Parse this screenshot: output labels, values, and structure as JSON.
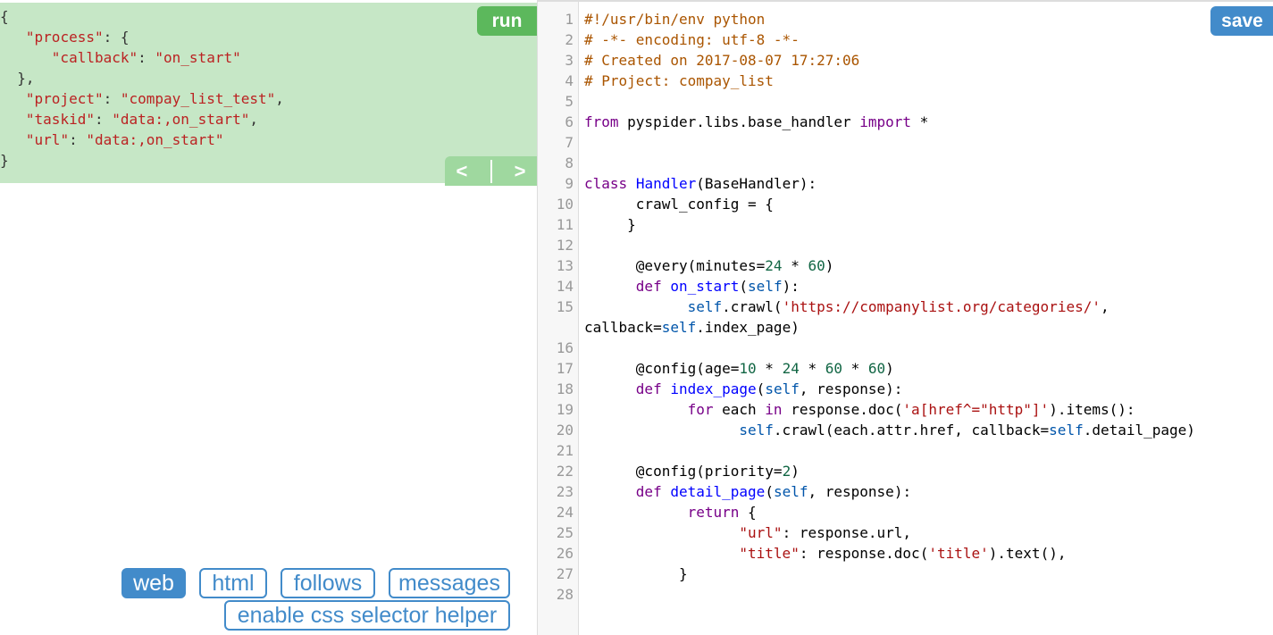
{
  "left_panel": {
    "task_json": {
      "lines": [
        [
          {
            "t": "{",
            "c": "p"
          }
        ],
        [
          {
            "t": "   ",
            "c": "p"
          },
          {
            "t": "\"process\"",
            "c": "s"
          },
          {
            "t": ": {",
            "c": "p"
          }
        ],
        [
          {
            "t": "      ",
            "c": "p"
          },
          {
            "t": "\"callback\"",
            "c": "s"
          },
          {
            "t": ": ",
            "c": "p"
          },
          {
            "t": "\"on_start\"",
            "c": "s"
          }
        ],
        [
          {
            "t": "  },",
            "c": "p"
          }
        ],
        [
          {
            "t": "   ",
            "c": "p"
          },
          {
            "t": "\"project\"",
            "c": "s"
          },
          {
            "t": ": ",
            "c": "p"
          },
          {
            "t": "\"compay_list_test\"",
            "c": "s"
          },
          {
            "t": ",",
            "c": "p"
          }
        ],
        [
          {
            "t": "   ",
            "c": "p"
          },
          {
            "t": "\"taskid\"",
            "c": "s"
          },
          {
            "t": ": ",
            "c": "p"
          },
          {
            "t": "\"data:,on_start\"",
            "c": "s"
          },
          {
            "t": ",",
            "c": "p"
          }
        ],
        [
          {
            "t": "   ",
            "c": "p"
          },
          {
            "t": "\"url\"",
            "c": "s"
          },
          {
            "t": ": ",
            "c": "p"
          },
          {
            "t": "\"data:,on_start\"",
            "c": "s"
          }
        ],
        [
          {
            "t": "}",
            "c": "p"
          }
        ]
      ]
    },
    "run_label": "run",
    "prev_label": "<",
    "next_label": ">",
    "tabs": {
      "web": "web",
      "html": "html",
      "follows": "follows",
      "messages": "messages",
      "css_helper": "enable css selector helper"
    },
    "active_tab": "web"
  },
  "editor": {
    "save_label": "save",
    "lines": [
      {
        "n": "1",
        "s": [
          {
            "t": "#!/usr/bin/env python",
            "c": "cm"
          }
        ]
      },
      {
        "n": "2",
        "s": [
          {
            "t": "# -*- encoding: utf-8 -*-",
            "c": "cm"
          }
        ]
      },
      {
        "n": "3",
        "s": [
          {
            "t": "# Created on 2017-08-07 17:27:06",
            "c": "cm"
          }
        ]
      },
      {
        "n": "4",
        "s": [
          {
            "t": "# Project: compay_list",
            "c": "cm"
          }
        ]
      },
      {
        "n": "5",
        "s": []
      },
      {
        "n": "6",
        "s": [
          {
            "t": "from",
            "c": "kw"
          },
          {
            "t": " pyspider.libs.base_handler ",
            "c": ""
          },
          {
            "t": "import",
            "c": "kw"
          },
          {
            "t": " *",
            "c": ""
          }
        ]
      },
      {
        "n": "7",
        "s": []
      },
      {
        "n": "8",
        "s": []
      },
      {
        "n": "9",
        "s": [
          {
            "t": "class",
            "c": "kw"
          },
          {
            "t": " ",
            "c": ""
          },
          {
            "t": "Handler",
            "c": "df"
          },
          {
            "t": "(BaseHandler):",
            "c": ""
          }
        ]
      },
      {
        "n": "10",
        "s": [
          {
            "t": "      crawl_config = {",
            "c": ""
          }
        ]
      },
      {
        "n": "11",
        "s": [
          {
            "t": "     }",
            "c": ""
          }
        ]
      },
      {
        "n": "12",
        "s": []
      },
      {
        "n": "13",
        "s": [
          {
            "t": "      @every(minutes=",
            "c": ""
          },
          {
            "t": "24",
            "c": "nm"
          },
          {
            "t": " * ",
            "c": ""
          },
          {
            "t": "60",
            "c": "nm"
          },
          {
            "t": ")",
            "c": ""
          }
        ]
      },
      {
        "n": "14",
        "s": [
          {
            "t": "      ",
            "c": ""
          },
          {
            "t": "def",
            "c": "kw"
          },
          {
            "t": " ",
            "c": ""
          },
          {
            "t": "on_start",
            "c": "df"
          },
          {
            "t": "(",
            "c": ""
          },
          {
            "t": "self",
            "c": "vr"
          },
          {
            "t": "):",
            "c": ""
          }
        ]
      },
      {
        "n": "15",
        "s": [
          {
            "t": "            ",
            "c": ""
          },
          {
            "t": "self",
            "c": "vr"
          },
          {
            "t": ".crawl(",
            "c": ""
          },
          {
            "t": "'https://companylist.org/categories/'",
            "c": "st"
          },
          {
            "t": ",",
            "c": ""
          }
        ]
      },
      {
        "n": "",
        "s": [
          {
            "t": "callback=",
            "c": ""
          },
          {
            "t": "self",
            "c": "vr"
          },
          {
            "t": ".index_page)",
            "c": ""
          }
        ]
      },
      {
        "n": "16",
        "s": []
      },
      {
        "n": "17",
        "s": [
          {
            "t": "      @config(age=",
            "c": ""
          },
          {
            "t": "10",
            "c": "nm"
          },
          {
            "t": " * ",
            "c": ""
          },
          {
            "t": "24",
            "c": "nm"
          },
          {
            "t": " * ",
            "c": ""
          },
          {
            "t": "60",
            "c": "nm"
          },
          {
            "t": " * ",
            "c": ""
          },
          {
            "t": "60",
            "c": "nm"
          },
          {
            "t": ")",
            "c": ""
          }
        ]
      },
      {
        "n": "18",
        "s": [
          {
            "t": "      ",
            "c": ""
          },
          {
            "t": "def",
            "c": "kw"
          },
          {
            "t": " ",
            "c": ""
          },
          {
            "t": "index_page",
            "c": "df"
          },
          {
            "t": "(",
            "c": ""
          },
          {
            "t": "self",
            "c": "vr"
          },
          {
            "t": ", response):",
            "c": ""
          }
        ]
      },
      {
        "n": "19",
        "s": [
          {
            "t": "            ",
            "c": ""
          },
          {
            "t": "for",
            "c": "kw"
          },
          {
            "t": " each ",
            "c": ""
          },
          {
            "t": "in",
            "c": "kw"
          },
          {
            "t": " response.doc(",
            "c": ""
          },
          {
            "t": "'a[href^=\"http\"]'",
            "c": "st"
          },
          {
            "t": ").items():",
            "c": ""
          }
        ]
      },
      {
        "n": "20",
        "s": [
          {
            "t": "                  ",
            "c": ""
          },
          {
            "t": "self",
            "c": "vr"
          },
          {
            "t": ".crawl(each.attr.href, callback=",
            "c": ""
          },
          {
            "t": "self",
            "c": "vr"
          },
          {
            "t": ".detail_page)",
            "c": ""
          }
        ]
      },
      {
        "n": "21",
        "s": []
      },
      {
        "n": "22",
        "s": [
          {
            "t": "      @config(priority=",
            "c": ""
          },
          {
            "t": "2",
            "c": "nm"
          },
          {
            "t": ")",
            "c": ""
          }
        ]
      },
      {
        "n": "23",
        "s": [
          {
            "t": "      ",
            "c": ""
          },
          {
            "t": "def",
            "c": "kw"
          },
          {
            "t": " ",
            "c": ""
          },
          {
            "t": "detail_page",
            "c": "df"
          },
          {
            "t": "(",
            "c": ""
          },
          {
            "t": "self",
            "c": "vr"
          },
          {
            "t": ", response):",
            "c": ""
          }
        ]
      },
      {
        "n": "24",
        "s": [
          {
            "t": "            ",
            "c": ""
          },
          {
            "t": "return",
            "c": "kw"
          },
          {
            "t": " {",
            "c": ""
          }
        ]
      },
      {
        "n": "25",
        "s": [
          {
            "t": "                  ",
            "c": ""
          },
          {
            "t": "\"url\"",
            "c": "st"
          },
          {
            "t": ": response.url,",
            "c": ""
          }
        ]
      },
      {
        "n": "26",
        "s": [
          {
            "t": "                  ",
            "c": ""
          },
          {
            "t": "\"title\"",
            "c": "st"
          },
          {
            "t": ": response.doc(",
            "c": ""
          },
          {
            "t": "'title'",
            "c": "st"
          },
          {
            "t": ").text(),",
            "c": ""
          }
        ]
      },
      {
        "n": "27",
        "s": [
          {
            "t": "           }",
            "c": ""
          }
        ]
      },
      {
        "n": "28",
        "s": []
      }
    ]
  },
  "colors": {
    "task_bg": "#c6e7c6",
    "run_btn": "#5cb85c",
    "nav_btn": "#9fd89f",
    "accent": "#428bca"
  }
}
